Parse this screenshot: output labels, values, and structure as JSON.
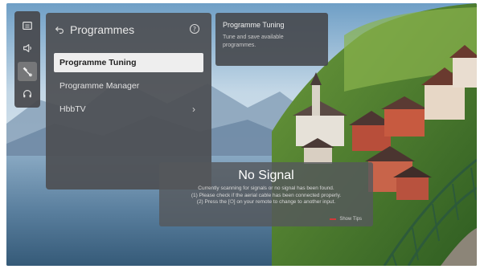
{
  "sidebar": {
    "icons": [
      "picture-icon",
      "sound-icon",
      "settings-wrench-icon",
      "support-headset-icon"
    ],
    "active_index": 2
  },
  "panel": {
    "title": "Programmes",
    "items": [
      {
        "label": "Programme Tuning",
        "selected": true
      },
      {
        "label": "Programme Manager",
        "selected": false
      },
      {
        "label": "HbbTV",
        "selected": false,
        "chevron": "›"
      }
    ]
  },
  "info": {
    "title": "Programme Tuning",
    "description_line1": "Tune and save available",
    "description_line2": "programmes."
  },
  "no_signal": {
    "title": "No Signal",
    "line1": "Currently scanning for signals or no signal has been found.",
    "line2": "(1) Please check if the aerial cable has been connected properly.",
    "line3": "(2) Press the [⏻] on your remote to change to another input.",
    "more_label": "Show Tips"
  },
  "colors": {
    "panel_bg": "#4e5054",
    "selected_bg": "#eeeeee",
    "accent_red": "#d23a3a"
  }
}
